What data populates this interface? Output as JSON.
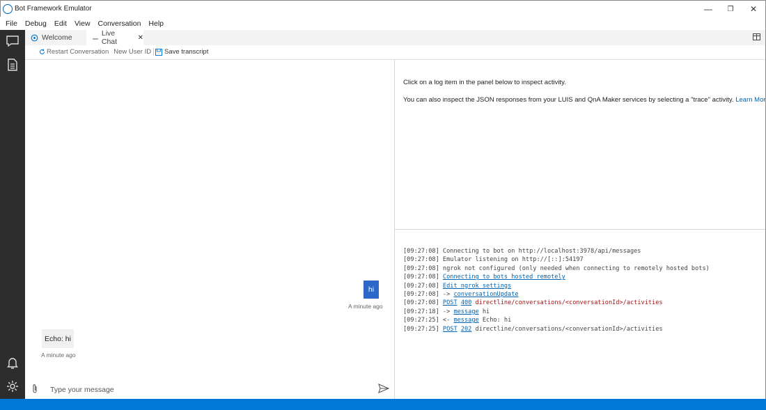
{
  "window": {
    "title": "Bot Framework Emulator",
    "minimize_glyph": "—",
    "restore_glyph": "❐",
    "close_glyph": "✕"
  },
  "menu": [
    "File",
    "Debug",
    "Edit",
    "View",
    "Conversation",
    "Help"
  ],
  "sidebar_icons": [
    "chat-icon",
    "document-icon",
    "bell-icon",
    "gear-icon"
  ],
  "tabs": [
    {
      "label": "Welcome",
      "icon": "bot-icon"
    },
    {
      "label": "Live Chat",
      "icon": "chat-lines-icon",
      "close": "✕"
    }
  ],
  "toolbar": {
    "restart_label": "Restart Conversation",
    "user_id_label": "New User ID",
    "save_label": "Save transcript"
  },
  "chat": {
    "messages": [
      {
        "from": "user",
        "text": "hi",
        "time": "A minute ago"
      },
      {
        "from": "bot",
        "text": "Echo: hi",
        "time": "A minute ago"
      }
    ],
    "input_placeholder": "Type your message"
  },
  "inspector": {
    "line1": "Click on a log item in the panel below to inspect activity.",
    "line2": "You can also inspect the JSON responses from your LUIS and QnA Maker services by selecting a \"trace\" activity.",
    "learn_more": "Learn More."
  },
  "log": [
    {
      "time": "[09:27:08]",
      "parts": [
        {
          "t": "Connecting to bot on http://localhost:3978/api/messages",
          "s": "plain"
        }
      ]
    },
    {
      "time": "[09:27:08]",
      "parts": [
        {
          "t": "Emulator listening on http://[::]:54197",
          "s": "plain"
        }
      ]
    },
    {
      "time": "[09:27:08]",
      "parts": [
        {
          "t": "ngrok not configured (only needed when connecting to remotely hosted bots)",
          "s": "plain"
        }
      ]
    },
    {
      "time": "[09:27:08]",
      "parts": [
        {
          "t": "Connecting to bots hosted remotely",
          "s": "link"
        }
      ]
    },
    {
      "time": "[09:27:08]",
      "parts": [
        {
          "t": "Edit ngrok settings",
          "s": "link"
        }
      ]
    },
    {
      "time": "[09:27:08]",
      "parts": [
        {
          "t": " -> ",
          "s": "plain"
        },
        {
          "t": "conversationUpdate",
          "s": "link"
        }
      ]
    },
    {
      "time": "[09:27:08]",
      "parts": [
        {
          "t": "POST",
          "s": "link"
        },
        {
          "t": " ",
          "s": "plain"
        },
        {
          "t": "400",
          "s": "link"
        },
        {
          "t": " directline/conversations/<conversationId>/activities",
          "s": "err"
        }
      ]
    },
    {
      "time": "[09:27:18]",
      "parts": [
        {
          "t": "-> ",
          "s": "plain"
        },
        {
          "t": "message",
          "s": "link"
        },
        {
          "t": " hi",
          "s": "plain"
        }
      ]
    },
    {
      "time": "[09:27:25]",
      "parts": [
        {
          "t": "<- ",
          "s": "plain"
        },
        {
          "t": "message",
          "s": "link"
        },
        {
          "t": " Echo: hi",
          "s": "plain"
        }
      ]
    },
    {
      "time": "[09:27:25]",
      "parts": [
        {
          "t": "POST",
          "s": "link"
        },
        {
          "t": " ",
          "s": "plain"
        },
        {
          "t": "202",
          "s": "link"
        },
        {
          "t": " directline/conversations/<conversationId>/activities",
          "s": "plain"
        }
      ]
    }
  ],
  "colors": {
    "accent": "#0078d7",
    "sidebar": "#2d2d2d",
    "user_bubble": "#2c68c8",
    "link": "#0063b1",
    "error": "#a31515"
  }
}
